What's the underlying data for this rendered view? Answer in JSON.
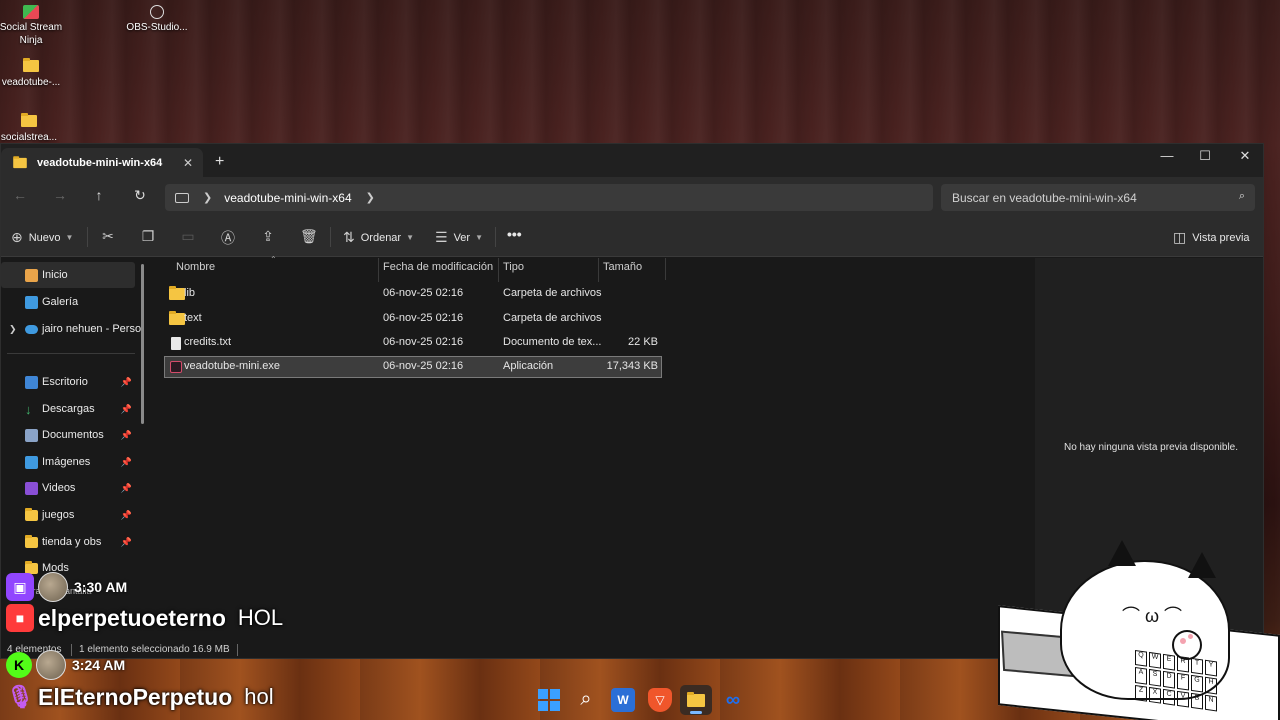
{
  "desktop": {
    "icons": [
      {
        "label": "Social Stream\nNinja",
        "icon": "social-stream-ninja-icon"
      },
      {
        "label": "OBS-Studio...",
        "icon": "obs-studio-icon"
      },
      {
        "label": "veadotube-...",
        "icon": "folder-icon"
      },
      {
        "label": "socialstrea...",
        "icon": "folder-icon"
      }
    ]
  },
  "window": {
    "tab_title": "veadotube-mini-win-x64",
    "tab_close": "✕",
    "new_tab": "+",
    "controls": {
      "minimize": "—",
      "maximize": "☐",
      "close": "✕"
    }
  },
  "navigation": {
    "back": "←",
    "forward": "→",
    "up": "↑",
    "refresh": "↻",
    "breadcrumb": "veadotube-mini-win-x64",
    "search_placeholder": "Buscar en veadotube-mini-win-x64"
  },
  "toolbar": {
    "new_label": "Nuevo",
    "sort_label": "Ordenar",
    "view_label": "Ver",
    "more": "•••",
    "preview_label": "Vista previa"
  },
  "sidebar": {
    "top": [
      {
        "label": "Inicio",
        "selected": true,
        "color": "#e9a44a"
      },
      {
        "label": "Galería",
        "selected": false,
        "color": "#3f9ae0"
      },
      {
        "label": "jairo nehuen - Person",
        "selected": false,
        "color": "#3f9ae0",
        "expandable": true
      }
    ],
    "pinned": [
      {
        "label": "Escritorio",
        "color": "#3f86d6"
      },
      {
        "label": "Descargas",
        "color": "#41b36c"
      },
      {
        "label": "Documentos",
        "color": "#8aa3c7"
      },
      {
        "label": "Imágenes",
        "color": "#3f9ae0"
      },
      {
        "label": "Videos",
        "color": "#8a4fd6"
      },
      {
        "label": "juegos",
        "color": "#f5c542"
      },
      {
        "label": "tienda y obs",
        "color": "#f5c542"
      },
      {
        "label": "Mods",
        "color": "#f5c542"
      }
    ],
    "partial_item": "...ras de pantalla"
  },
  "columns": {
    "name": "Nombre",
    "modified": "Fecha de modificación",
    "type": "Tipo",
    "size": "Tamaño"
  },
  "files": [
    {
      "name": "lib",
      "modified": "06-nov-25 02:16",
      "type": "Carpeta de archivos",
      "size": "",
      "kind": "folder"
    },
    {
      "name": "text",
      "modified": "06-nov-25 02:16",
      "type": "Carpeta de archivos",
      "size": "",
      "kind": "folder"
    },
    {
      "name": "credits.txt",
      "modified": "06-nov-25 02:16",
      "type": "Documento de tex...",
      "size": "22 KB",
      "kind": "file"
    },
    {
      "name": "veadotube-mini.exe",
      "modified": "06-nov-25 02:16",
      "type": "Aplicación",
      "size": "17,343 KB",
      "kind": "exe",
      "selected": true
    }
  ],
  "preview": {
    "empty_text": "No hay ninguna vista previa disponible."
  },
  "status": {
    "count": "4 elementos",
    "selection": "1 elemento seleccionado 16.9 MB"
  },
  "chat": [
    {
      "platform": "twitch",
      "platform_color": "#9146ff",
      "time": "3:30 AM",
      "name": "elperpetuoeterno",
      "message": "HOL",
      "name_icon_color": "#ff3b3b"
    },
    {
      "platform": "kick",
      "platform_color": "#53fc18",
      "time": "3:24 AM",
      "name": "ElEternoPerpetuo",
      "message": "hol",
      "name_icon_color": "#c45cf0"
    }
  ],
  "taskbar": {
    "apps": [
      {
        "name": "windows-start",
        "color": "#3aa0ff"
      },
      {
        "name": "search",
        "color": "#ffffff"
      },
      {
        "name": "word",
        "color": "#2b6fd6"
      },
      {
        "name": "brave",
        "color": "#f0562b"
      },
      {
        "name": "file-explorer",
        "color": "#f5c542"
      },
      {
        "name": "meta",
        "color": "#1e6ff0"
      }
    ]
  },
  "overlay": {
    "keyboard_keys": [
      "Q",
      "W",
      "E",
      "R",
      "T",
      "Y",
      "A",
      "S",
      "D",
      "F",
      "G",
      "H",
      "Z",
      "X",
      "C",
      "V",
      "B",
      "N"
    ]
  }
}
